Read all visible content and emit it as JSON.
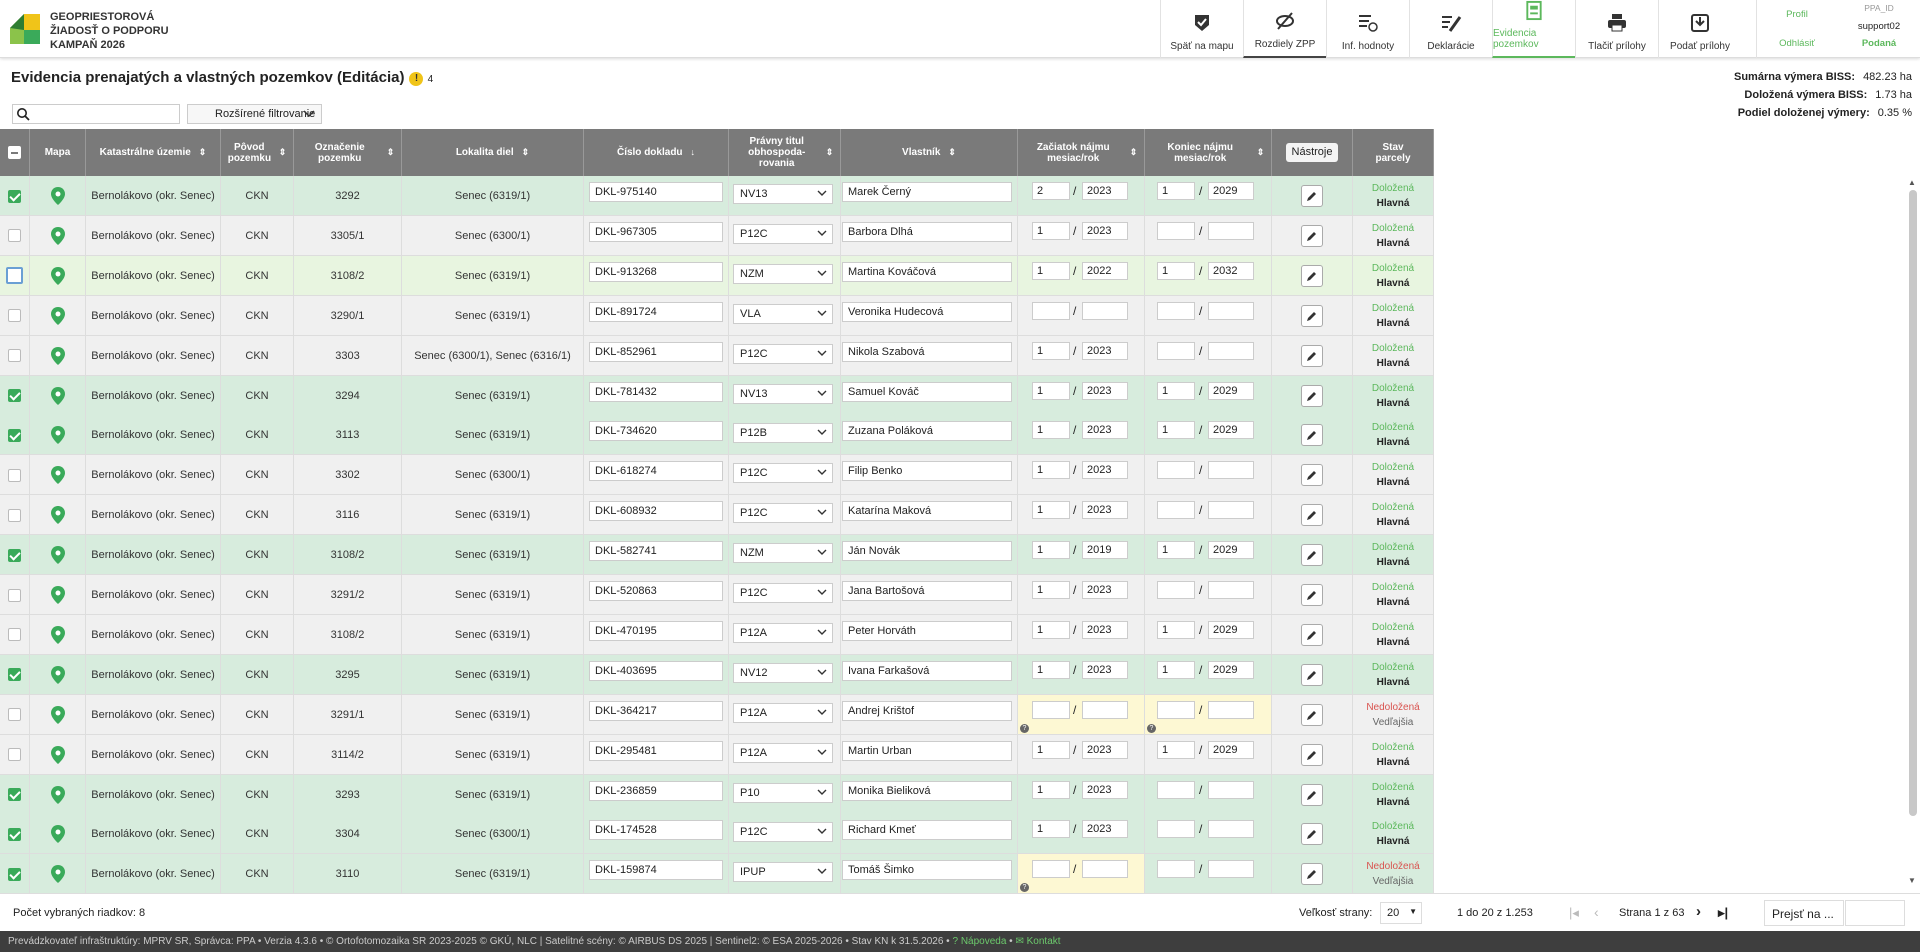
{
  "brand": {
    "line1": "GEOPRIESTOROVÁ",
    "line2": "ŽIADOSŤ O PODPORU",
    "line3": "KAMPAŇ 2026"
  },
  "nav": [
    {
      "label": "Späť na mapu",
      "icon": "shield-check-icon"
    },
    {
      "label": "Rozdiely ZPP",
      "icon": "eye-off-icon"
    },
    {
      "label": "Inf. hodnoty",
      "icon": "list-info-icon"
    },
    {
      "label": "Deklarácie",
      "icon": "edit-list-icon"
    },
    {
      "label": "Evidencia pozemkov",
      "icon": "document-icon"
    },
    {
      "label": "Tlačiť prílohy",
      "icon": "printer-icon"
    },
    {
      "label": "Podať prílohy",
      "icon": "download-icon"
    }
  ],
  "user": {
    "profile": "Profil",
    "ppa_id_label": "PPA_ID",
    "logout": "Odhlásiť",
    "username": "support02",
    "status": "Podaná"
  },
  "page": {
    "title": "Evidencia prenajatých a vlastných pozemkov (Editácia)",
    "warning_count": "4"
  },
  "stats": {
    "l1": "Sumárna výmera BISS:",
    "v1": "482.23 ha",
    "l2": "Doložená výmera BISS:",
    "v2": "1.73 ha",
    "l3": "Podiel doloženej výmery:",
    "v3": "0.35 %"
  },
  "search": {
    "placeholder": ""
  },
  "filter": {
    "label": "Rozšírené filtrovanie"
  },
  "columns": {
    "mapa": "Mapa",
    "ku": "Katastrálne územie",
    "povod": "Pôvod pozemku",
    "ozn": "Označenie pozemku",
    "lok": "Lokalita diel",
    "doc": "Číslo dokladu",
    "pravny": "Právny titul obhospoda- rovania",
    "vlastnik": "Vlastník",
    "zac": "Začiatok nájmu mesiac/rok",
    "kon": "Koniec nájmu mesiac/rok",
    "nastroje": "Nástroje",
    "stav": "Stav parcely"
  },
  "rows": [
    {
      "checked": true,
      "ku": "Bernolákovo (okr. Senec)",
      "povod": "CKN",
      "ozn": "3292",
      "lok": "Senec (6319/1)",
      "doc": "DKL-975140",
      "pravny": "NV13",
      "vlastnik": "Marek Černý",
      "zm": "2",
      "zr": "2023",
      "km": "1",
      "kr": "2029",
      "s1": "Doložená",
      "s2": "Hlavná"
    },
    {
      "checked": false,
      "ku": "Bernolákovo (okr. Senec)",
      "povod": "CKN",
      "ozn": "3305/1",
      "lok": "Senec (6300/1)",
      "doc": "DKL-967305",
      "pravny": "P12C",
      "vlastnik": "Barbora Dlhá",
      "zm": "1",
      "zr": "2023",
      "km": "",
      "kr": "",
      "s1": "Doložená",
      "s2": "Hlavná"
    },
    {
      "checked": false,
      "focus": true,
      "ku": "Bernolákovo (okr. Senec)",
      "povod": "CKN",
      "ozn": "3108/2",
      "lok": "Senec (6319/1)",
      "doc": "DKL-913268",
      "pravny": "NZM",
      "vlastnik": "Martina Kováčová",
      "zm": "1",
      "zr": "2022",
      "km": "1",
      "kr": "2032",
      "s1": "Doložená",
      "s2": "Hlavná"
    },
    {
      "checked": false,
      "ku": "Bernolákovo (okr. Senec)",
      "povod": "CKN",
      "ozn": "3290/1",
      "lok": "Senec (6319/1)",
      "doc": "DKL-891724",
      "pravny": "VLA",
      "vlastnik": "Veronika Hudecová",
      "zm": "",
      "zr": "",
      "km": "",
      "kr": "",
      "s1": "Doložená",
      "s2": "Hlavná"
    },
    {
      "checked": false,
      "ku": "Bernolákovo (okr. Senec)",
      "povod": "CKN",
      "ozn": "3303",
      "lok": "Senec (6300/1), Senec (6316/1)",
      "doc": "DKL-852961",
      "pravny": "P12C",
      "vlastnik": "Nikola Szabová",
      "zm": "1",
      "zr": "2023",
      "km": "",
      "kr": "",
      "s1": "Doložená",
      "s2": "Hlavná"
    },
    {
      "checked": true,
      "ku": "Bernolákovo (okr. Senec)",
      "povod": "CKN",
      "ozn": "3294",
      "lok": "Senec (6319/1)",
      "doc": "DKL-781432",
      "pravny": "NV13",
      "vlastnik": "Samuel Kováč",
      "zm": "1",
      "zr": "2023",
      "km": "1",
      "kr": "2029",
      "s1": "Doložená",
      "s2": "Hlavná"
    },
    {
      "checked": true,
      "ku": "Bernolákovo (okr. Senec)",
      "povod": "CKN",
      "ozn": "3113",
      "lok": "Senec (6319/1)",
      "doc": "DKL-734620",
      "pravny": "P12B",
      "vlastnik": "Zuzana Poláková",
      "zm": "1",
      "zr": "2023",
      "km": "1",
      "kr": "2029",
      "s1": "Doložená",
      "s2": "Hlavná"
    },
    {
      "checked": false,
      "ku": "Bernolákovo (okr. Senec)",
      "povod": "CKN",
      "ozn": "3302",
      "lok": "Senec (6300/1)",
      "doc": "DKL-618274",
      "pravny": "P12C",
      "vlastnik": "Filip Benko",
      "zm": "1",
      "zr": "2023",
      "km": "",
      "kr": "",
      "s1": "Doložená",
      "s2": "Hlavná"
    },
    {
      "checked": false,
      "ku": "Bernolákovo (okr. Senec)",
      "povod": "CKN",
      "ozn": "3116",
      "lok": "Senec (6319/1)",
      "doc": "DKL-608932",
      "pravny": "P12C",
      "vlastnik": "Katarína Maková",
      "zm": "1",
      "zr": "2023",
      "km": "",
      "kr": "",
      "s1": "Doložená",
      "s2": "Hlavná"
    },
    {
      "checked": true,
      "ku": "Bernolákovo (okr. Senec)",
      "povod": "CKN",
      "ozn": "3108/2",
      "lok": "Senec (6319/1)",
      "doc": "DKL-582741",
      "pravny": "NZM",
      "vlastnik": "Ján Novák",
      "zm": "1",
      "zr": "2019",
      "km": "1",
      "kr": "2029",
      "s1": "Doložená",
      "s2": "Hlavná"
    },
    {
      "checked": false,
      "ku": "Bernolákovo (okr. Senec)",
      "povod": "CKN",
      "ozn": "3291/2",
      "lok": "Senec (6319/1)",
      "doc": "DKL-520863",
      "pravny": "P12C",
      "vlastnik": "Jana Bartošová",
      "zm": "1",
      "zr": "2023",
      "km": "",
      "kr": "",
      "s1": "Doložená",
      "s2": "Hlavná"
    },
    {
      "checked": false,
      "ku": "Bernolákovo (okr. Senec)",
      "povod": "CKN",
      "ozn": "3108/2",
      "lok": "Senec (6319/1)",
      "doc": "DKL-470195",
      "pravny": "P12A",
      "vlastnik": "Peter Horváth",
      "zm": "1",
      "zr": "2023",
      "km": "1",
      "kr": "2029",
      "s1": "Doložená",
      "s2": "Hlavná"
    },
    {
      "checked": true,
      "ku": "Bernolákovo (okr. Senec)",
      "povod": "CKN",
      "ozn": "3295",
      "lok": "Senec (6319/1)",
      "doc": "DKL-403695",
      "pravny": "NV12",
      "vlastnik": "Ivana Farkašová",
      "zm": "1",
      "zr": "2023",
      "km": "1",
      "kr": "2029",
      "s1": "Doložená",
      "s2": "Hlavná"
    },
    {
      "checked": false,
      "ku": "Bernolákovo (okr. Senec)",
      "povod": "CKN",
      "ozn": "3291/1",
      "lok": "Senec (6319/1)",
      "doc": "DKL-364217",
      "pravny": "P12A",
      "vlastnik": "Andrej Krištof",
      "zm": "",
      "zr": "",
      "km": "",
      "kr": "",
      "s1": "Nedoložená",
      "s2": "Vedľajšia",
      "bad": true,
      "yz": true,
      "yk": true
    },
    {
      "checked": false,
      "ku": "Bernolákovo (okr. Senec)",
      "povod": "CKN",
      "ozn": "3114/2",
      "lok": "Senec (6319/1)",
      "doc": "DKL-295481",
      "pravny": "P12A",
      "vlastnik": "Martin Urban",
      "zm": "1",
      "zr": "2023",
      "km": "1",
      "kr": "2029",
      "s1": "Doložená",
      "s2": "Hlavná"
    },
    {
      "checked": true,
      "ku": "Bernolákovo (okr. Senec)",
      "povod": "CKN",
      "ozn": "3293",
      "lok": "Senec (6319/1)",
      "doc": "DKL-236859",
      "pravny": "P10",
      "vlastnik": "Monika Bieliková",
      "zm": "1",
      "zr": "2023",
      "km": "",
      "kr": "",
      "s1": "Doložená",
      "s2": "Hlavná"
    },
    {
      "checked": true,
      "ku": "Bernolákovo (okr. Senec)",
      "povod": "CKN",
      "ozn": "3304",
      "lok": "Senec (6300/1)",
      "doc": "DKL-174528",
      "pravny": "P12C",
      "vlastnik": "Richard Kmeť",
      "zm": "1",
      "zr": "2023",
      "km": "",
      "kr": "",
      "s1": "Doložená",
      "s2": "Hlavná"
    },
    {
      "checked": true,
      "ku": "Bernolákovo (okr. Senec)",
      "povod": "CKN",
      "ozn": "3110",
      "lok": "Senec (6319/1)",
      "doc": "DKL-159874",
      "pravny": "IPUP",
      "vlastnik": "Tomáš Šimko",
      "zm": "",
      "zr": "",
      "km": "",
      "kr": "",
      "s1": "Nedoložená",
      "s2": "Vedľajšia",
      "bad": true,
      "yz": true
    }
  ],
  "footer": {
    "selected": "Počet vybraných riadkov: 8",
    "page_size_label": "Veľkosť strany:",
    "page_size": "20",
    "range": "1 do 20 z 1.253",
    "page": "Strana 1 z 63",
    "goto": "Prejsť na ..."
  },
  "bottom": {
    "text": "Prevádzkovateľ infraštruktúry: MPRV SR, Správca: PPA • Verzia 4.3.6 • © Ortofotomozaika SR 2023-2025 © GKÚ, NLC | Satelitné scény: © AIRBUS DS 2025 | Sentinel2: © ESA 2025-2026 • Stav KN k 31.5.2026 •",
    "help": "Nápoveda",
    "contact": "Kontakt"
  },
  "colors": {
    "accent": "#5cb85c",
    "header_bg": "#7a7a7a",
    "row_green": "#d7ecdd"
  }
}
